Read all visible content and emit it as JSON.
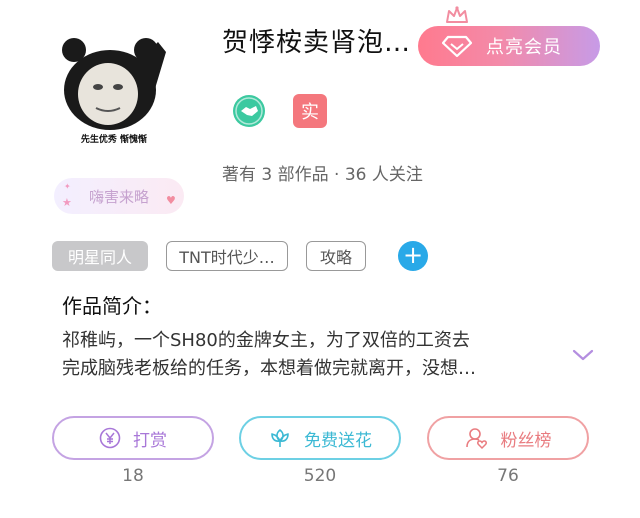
{
  "book": {
    "title": "贺悸桉卖肾泡…",
    "stats": "著有 3 部作品 · 36 人关注",
    "sticker_tag": "嗨害来略",
    "avatar_caption": "先生优秀 惭愧惭"
  },
  "vip": {
    "label": "点亮会员"
  },
  "badges": {
    "real": "实"
  },
  "tags": [
    {
      "label": "明星同人",
      "style": "filled"
    },
    {
      "label": "TNT时代少…",
      "style": "outline"
    },
    {
      "label": "攻略",
      "style": "outline"
    }
  ],
  "intro": {
    "heading": "作品简介：",
    "line1": "祁稚屿，一个SH80的金牌女主，为了双倍的工资去",
    "line2": "完成脑残老板给的任务，本想着做完就离开，没想…"
  },
  "actions": [
    {
      "label": "打赏",
      "count": "18",
      "icon": "yen-coin-icon"
    },
    {
      "label": "免费送花",
      "count": "520",
      "icon": "flower-icon"
    },
    {
      "label": "粉丝榜",
      "count": "76",
      "icon": "fan-rank-icon"
    }
  ],
  "colors": {
    "vip_gradient_start": "#ff7a8e",
    "vip_gradient_end": "#c79be7",
    "reward": "#a877d8",
    "flower": "#3cb9d4",
    "fans": "#e97c80",
    "add_tag": "#29a9e8",
    "real_badge": "#f4777d"
  }
}
